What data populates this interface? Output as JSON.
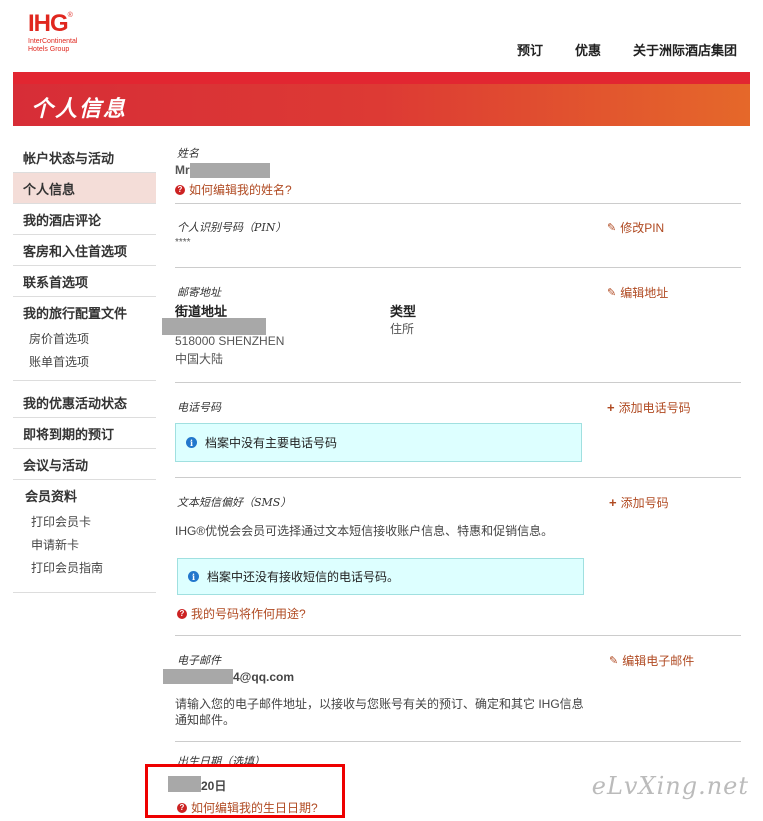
{
  "header": {
    "logo_text": "IHG",
    "logo_sub1": "InterContinental",
    "logo_sub2": "Hotels Group",
    "nav": [
      "预订",
      "优惠",
      "关于洲际酒店集团"
    ]
  },
  "banner": {
    "title": "个人信息"
  },
  "sidebar": {
    "items": [
      {
        "label": "帐户状态与活动"
      },
      {
        "label": "个人信息"
      },
      {
        "label": "我的酒店评论"
      },
      {
        "label": "客房和入住首选项"
      },
      {
        "label": "联系首选项"
      }
    ],
    "travel_profile": {
      "label": "我的旅行配置文件",
      "subs": [
        "房价首选项",
        "账单首选项"
      ]
    },
    "items2": [
      {
        "label": "我的优惠活动状态"
      },
      {
        "label": "即将到期的预订"
      },
      {
        "label": "会议与活动"
      }
    ],
    "member": {
      "label": "会员资料",
      "subs": [
        "打印会员卡",
        "申请新卡",
        "打印会员指南"
      ]
    }
  },
  "name_section": {
    "label": "姓名",
    "value": "Mr",
    "help": "如何编辑我的姓名?"
  },
  "pin_section": {
    "label": "个人识别号码（PIN）",
    "value": "****",
    "action": "修改PIN"
  },
  "address_section": {
    "label": "邮寄地址",
    "street_label": "街道地址",
    "type_label": "类型",
    "type_value": "住所",
    "city": "518000 SHENZHEN",
    "country": "中国大陆",
    "action": "编辑地址"
  },
  "phone_section": {
    "label": "电话号码",
    "action": "添加电话号码",
    "info": "档案中没有主要电话号码"
  },
  "sms_section": {
    "label": "文本短信偏好（SMS）",
    "action": "添加号码",
    "desc": "IHG®优悦会会员可选择通过文本短信接收账户信息、特惠和促销信息。",
    "info": "档案中还没有接收短信的电话号码。",
    "help": "我的号码将作何用途?"
  },
  "email_section": {
    "label": "电子邮件",
    "value": "4@qq.com",
    "action": "编辑电子邮件",
    "desc_line1": "请输入您的电子邮件地址，以接收与您账号有关的预订、确定和其它 IHG信息",
    "desc_line2": "通知邮件。"
  },
  "birthday_section": {
    "label": "出生日期（选填）",
    "value": "20日",
    "help": "如何编辑我的生日日期?"
  },
  "watermark": "eLvXing.net"
}
